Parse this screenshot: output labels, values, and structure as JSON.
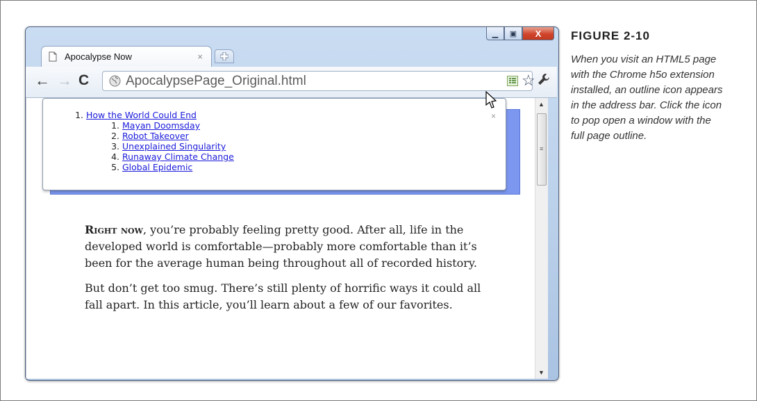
{
  "tab": {
    "title": "Apocalypse Now",
    "close": "×"
  },
  "toolbar": {
    "url": "ApocalypsePage_Original.html"
  },
  "window_controls": {
    "minimize": "▁",
    "maximize": "▣",
    "close": "X"
  },
  "outline_popup": {
    "close": "×",
    "items": [
      {
        "number": "1.",
        "label": "How the World Could End"
      }
    ],
    "subitems": [
      {
        "label": "Mayan Doomsday"
      },
      {
        "label": "Robot Takeover"
      },
      {
        "label": "Unexplained Singularity"
      },
      {
        "label": "Runaway Climate Change"
      },
      {
        "label": "Global Epidemic"
      }
    ]
  },
  "article": {
    "lead_in": "Right now",
    "paragraph1_rest": ", you’re probably feeling pretty good. After all, life in the developed world is comfortable—probably more comfortable than it’s been for the average human being throughout all of recorded history.",
    "paragraph2": "But don’t get too smug. There’s still plenty of horrific ways it could all fall apart. In this article, you’ll learn about a few of our favorites."
  },
  "caption": {
    "title": "FIGURE 2-10",
    "text": "When you visit an HTML5 page with the Chrome h5o extension installed, an outline icon appears in the address bar. Click the icon to pop open a window with the full page outline."
  },
  "icons": {
    "back": "back-arrow-icon",
    "forward": "forward-arrow-icon",
    "reload": "reload-icon",
    "globe": "globe-icon",
    "outline": "outline-icon",
    "star": "star-icon",
    "wrench": "wrench-icon"
  },
  "colors": {
    "banner": "#7c97f0",
    "link": "#1a1adb",
    "window_close": "#d0452c"
  }
}
